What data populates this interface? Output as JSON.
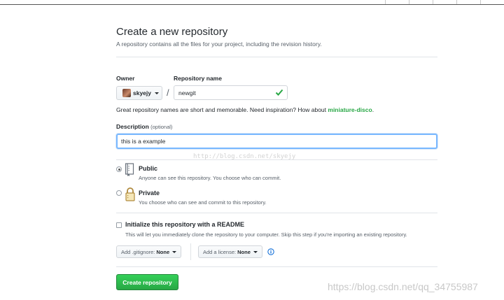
{
  "header": {
    "title": "Create a new repository",
    "subtitle": "A repository contains all the files for your project, including the revision history."
  },
  "owner": {
    "label": "Owner",
    "value": "skyejy"
  },
  "repo_name": {
    "label": "Repository name",
    "value": "newgit",
    "valid": true
  },
  "hint": {
    "text": "Great repository names are short and memorable. Need inspiration? How about ",
    "suggestion": "miniature-disco",
    "end": "."
  },
  "description": {
    "label": "Description",
    "optional": "(optional)",
    "value": "this is a example"
  },
  "visibility": {
    "public_title": "Public",
    "public_desc": "Anyone can see this repository. You choose who can commit.",
    "private_title": "Private",
    "private_desc": "You choose who can see and commit to this repository.",
    "selected": "public"
  },
  "readme": {
    "title": "Initialize this repository with a README",
    "desc": "This will let you immediately clone the repository to your computer. Skip this step if you're importing an existing repository.",
    "checked": false
  },
  "gitignore": {
    "prefix": "Add .gitignore:",
    "value": "None"
  },
  "license": {
    "prefix": "Add a license:",
    "value": "None"
  },
  "create_label": "Create repository",
  "watermarks": {
    "middle": "http://blog.csdn.net/skyejy",
    "bottom_right": "https://blog.csdn.net/qq_34755987"
  },
  "colors": {
    "accent_green": "#28a745",
    "focus_blue": "#79b8ff",
    "info_blue": "#0366d6"
  },
  "icons": [
    "repo-icon",
    "lock-icon",
    "check-icon",
    "info-icon",
    "caret-down-icon"
  ]
}
